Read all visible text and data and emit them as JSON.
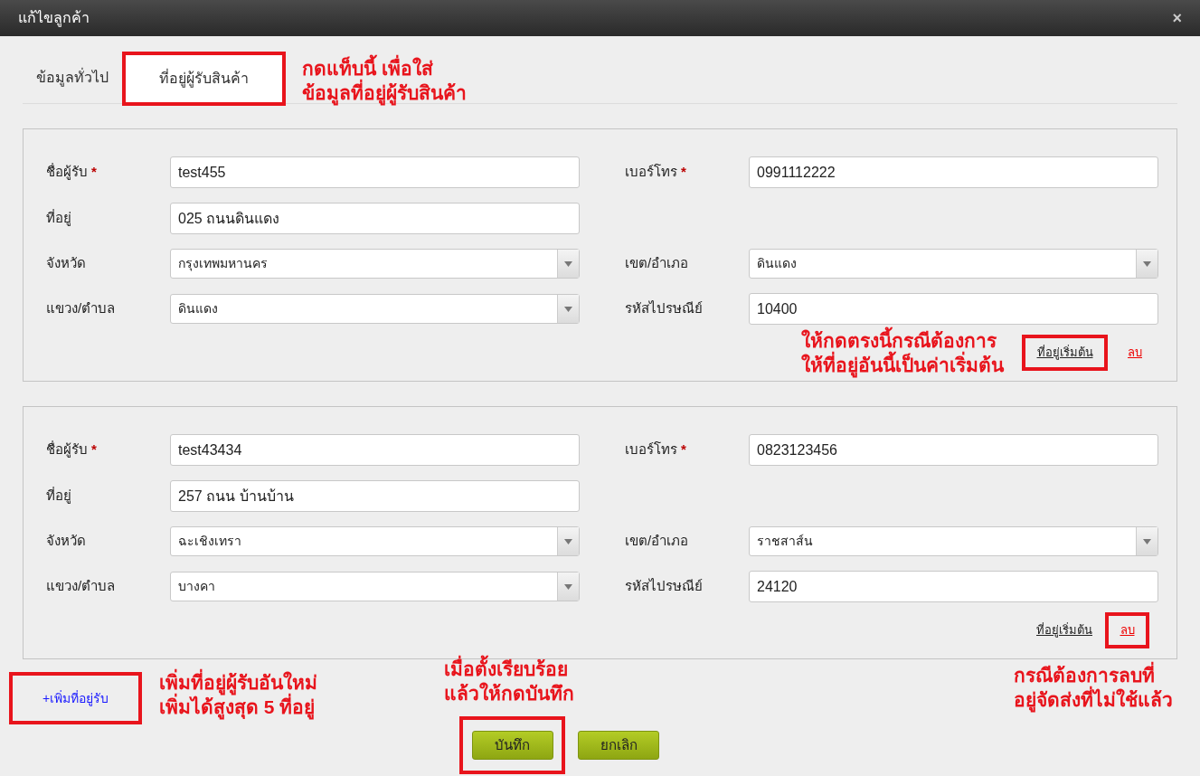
{
  "dialog": {
    "title": "แก้ไขลูกค้า",
    "close": "×"
  },
  "tabs": [
    {
      "label": "ข้อมูลทั่วไป",
      "selected": false,
      "highlighted": false
    },
    {
      "label": "ที่อยู่ผู้รับสินค้า",
      "selected": true,
      "highlighted": true
    }
  ],
  "tab_note": "กดแท็บนี้ เพื่อใส่\nข้อมูลที่อยู่ผู้รับสินค้า",
  "addresses": [
    {
      "rows": [
        [
          {
            "kind": "input",
            "label": "ชื่อผู้รับ",
            "required_mark": "*",
            "value": "test455"
          },
          {
            "kind": "input",
            "label": "เบอร์โทร",
            "required_mark": "*",
            "value": "0991112222"
          }
        ],
        [
          {
            "kind": "input",
            "label": "ที่อยู่",
            "value": "025 ถนนดินแดง"
          }
        ],
        [
          {
            "kind": "select",
            "label": "จังหวัด",
            "value": "กรุงเทพมหานคร"
          },
          {
            "kind": "select",
            "label": "เขต/อำเภอ",
            "value": "ดินแดง"
          }
        ],
        [
          {
            "kind": "select",
            "label": "แขวง/ตำบล",
            "value": "ดินแดง"
          },
          {
            "kind": "input",
            "label": "รหัสไปรษณีย์",
            "value": "10400"
          }
        ]
      ],
      "note": "ให้กดตรงนี้กรณีต้องการ\nให้ที่อยู่อันนี้เป็นค่าเริ่มต้น",
      "default_link": {
        "label": "ที่อยู่เริ่มต้น",
        "highlighted": true
      },
      "delete_link": {
        "label": "ลบ",
        "highlighted": false
      }
    },
    {
      "rows": [
        [
          {
            "kind": "input",
            "label": "ชื่อผู้รับ",
            "required_mark": "*",
            "value": "test43434"
          },
          {
            "kind": "input",
            "label": "เบอร์โทร",
            "required_mark": "*",
            "value": "0823123456"
          }
        ],
        [
          {
            "kind": "input",
            "label": "ที่อยู่",
            "value": "257 ถนน บ้านบ้าน"
          }
        ],
        [
          {
            "kind": "select",
            "label": "จังหวัด",
            "value": "ฉะเชิงเทรา"
          },
          {
            "kind": "select",
            "label": "เขต/อำเภอ",
            "value": "ราชสาส์น"
          }
        ],
        [
          {
            "kind": "select",
            "label": "แขวง/ตำบล",
            "value": "บางคา"
          },
          {
            "kind": "input",
            "label": "รหัสไปรษณีย์",
            "value": "24120"
          }
        ]
      ],
      "default_link": {
        "label": "ที่อยู่เริ่มต้น",
        "highlighted": false
      },
      "delete_link": {
        "label": "ลบ",
        "highlighted": true
      }
    }
  ],
  "add_link": {
    "label": "+เพิ่มที่อยู่รับ",
    "highlighted": true
  },
  "add_note": "เพิ่มที่อยู่ผู้รับอันใหม่\nเพิ่มได้สูงสุด 5 ที่อยู่",
  "save_note": "เมื่อตั้งเรียบร้อย\nแล้วให้กดบันทึก",
  "buttons": [
    {
      "label": "บันทึก",
      "highlighted": true
    },
    {
      "label": "ยกเลิก",
      "highlighted": false
    }
  ],
  "delete_note": "กรณีต้องการลบที่\nอยู่จัดส่งที่ไม่ใช้แล้ว"
}
